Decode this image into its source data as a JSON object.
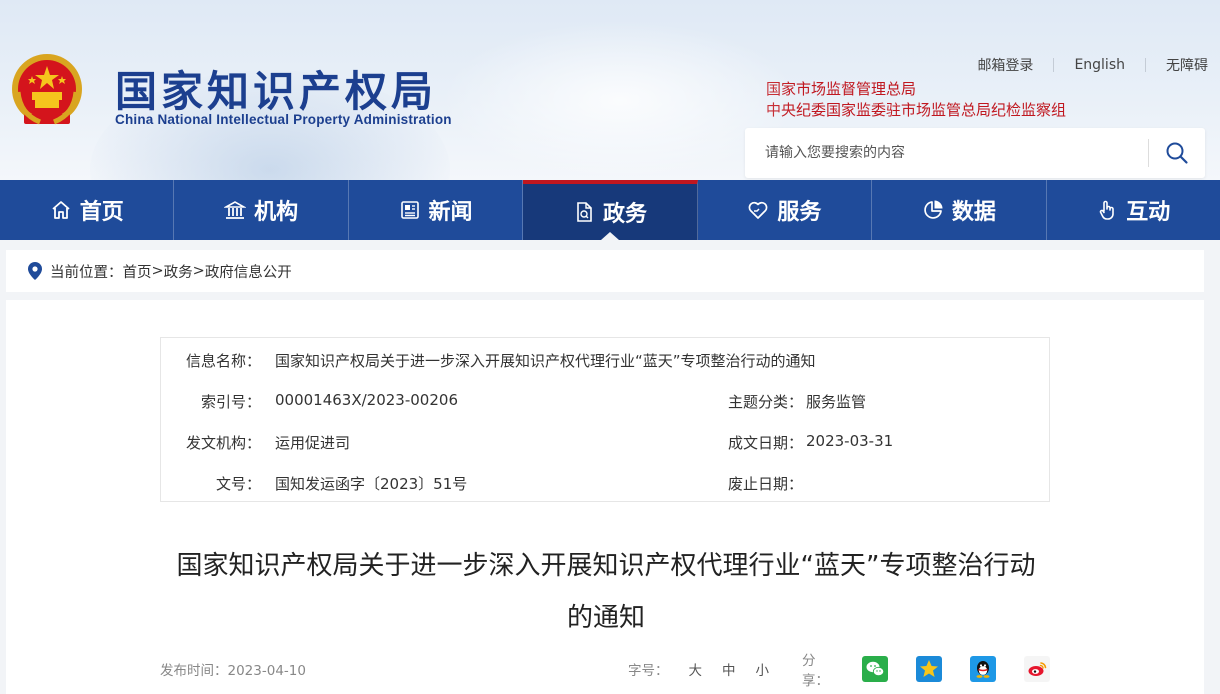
{
  "header": {
    "logo_cn": "国家知识产权局",
    "logo_en": "China National Intellectual Property Administration",
    "top_links": [
      "邮箱登录",
      "English",
      "无障碍"
    ],
    "agencies": [
      "国家市场监督管理总局",
      "中央纪委国家监委驻市场监管总局纪检监察组"
    ],
    "search_placeholder": "请输入您要搜索的内容"
  },
  "nav": [
    {
      "label": "首页",
      "icon": "home-icon"
    },
    {
      "label": "机构",
      "icon": "institution-icon"
    },
    {
      "label": "新闻",
      "icon": "news-icon"
    },
    {
      "label": "政务",
      "icon": "document-icon",
      "active": true
    },
    {
      "label": "服务",
      "icon": "service-heart-icon"
    },
    {
      "label": "数据",
      "icon": "pie-chart-icon"
    },
    {
      "label": "互动",
      "icon": "hand-pointer-icon"
    }
  ],
  "breadcrumb": {
    "prefix": "当前位置：",
    "items": [
      "首页",
      "政务",
      "政府信息公开"
    ],
    "separator": ">"
  },
  "meta": {
    "info_name_label": "信息名称：",
    "info_name_value": "国家知识产权局关于进一步深入开展知识产权代理行业“蓝天”专项整治行动的通知",
    "index_label": "索引号：",
    "index_value": "00001463X/2023-00206",
    "topic_label": "主题分类：",
    "topic_value": "服务监管",
    "issuer_label": "发文机构：",
    "issuer_value": "运用促进司",
    "date_label": "成文日期：",
    "date_value": "2023-03-31",
    "docno_label": "文号：",
    "docno_value": "国知发运函字〔2023〕51号",
    "expire_label": "废止日期：",
    "expire_value": ""
  },
  "article": {
    "title_line1": "国家知识产权局关于进一步深入开展知识产权代理行业“蓝天”专项整治行动",
    "title_line2": "的通知",
    "publish_time": "发布时间：2023-04-10",
    "font_size_label": "字号：",
    "font_sizes": [
      "大",
      "中",
      "小"
    ],
    "share_label": "分享："
  },
  "colors": {
    "nav_bg": "#1f4b9a",
    "nav_active": "#17397a",
    "accent_red": "#c0171f",
    "logo_blue": "#1c3f8f"
  }
}
